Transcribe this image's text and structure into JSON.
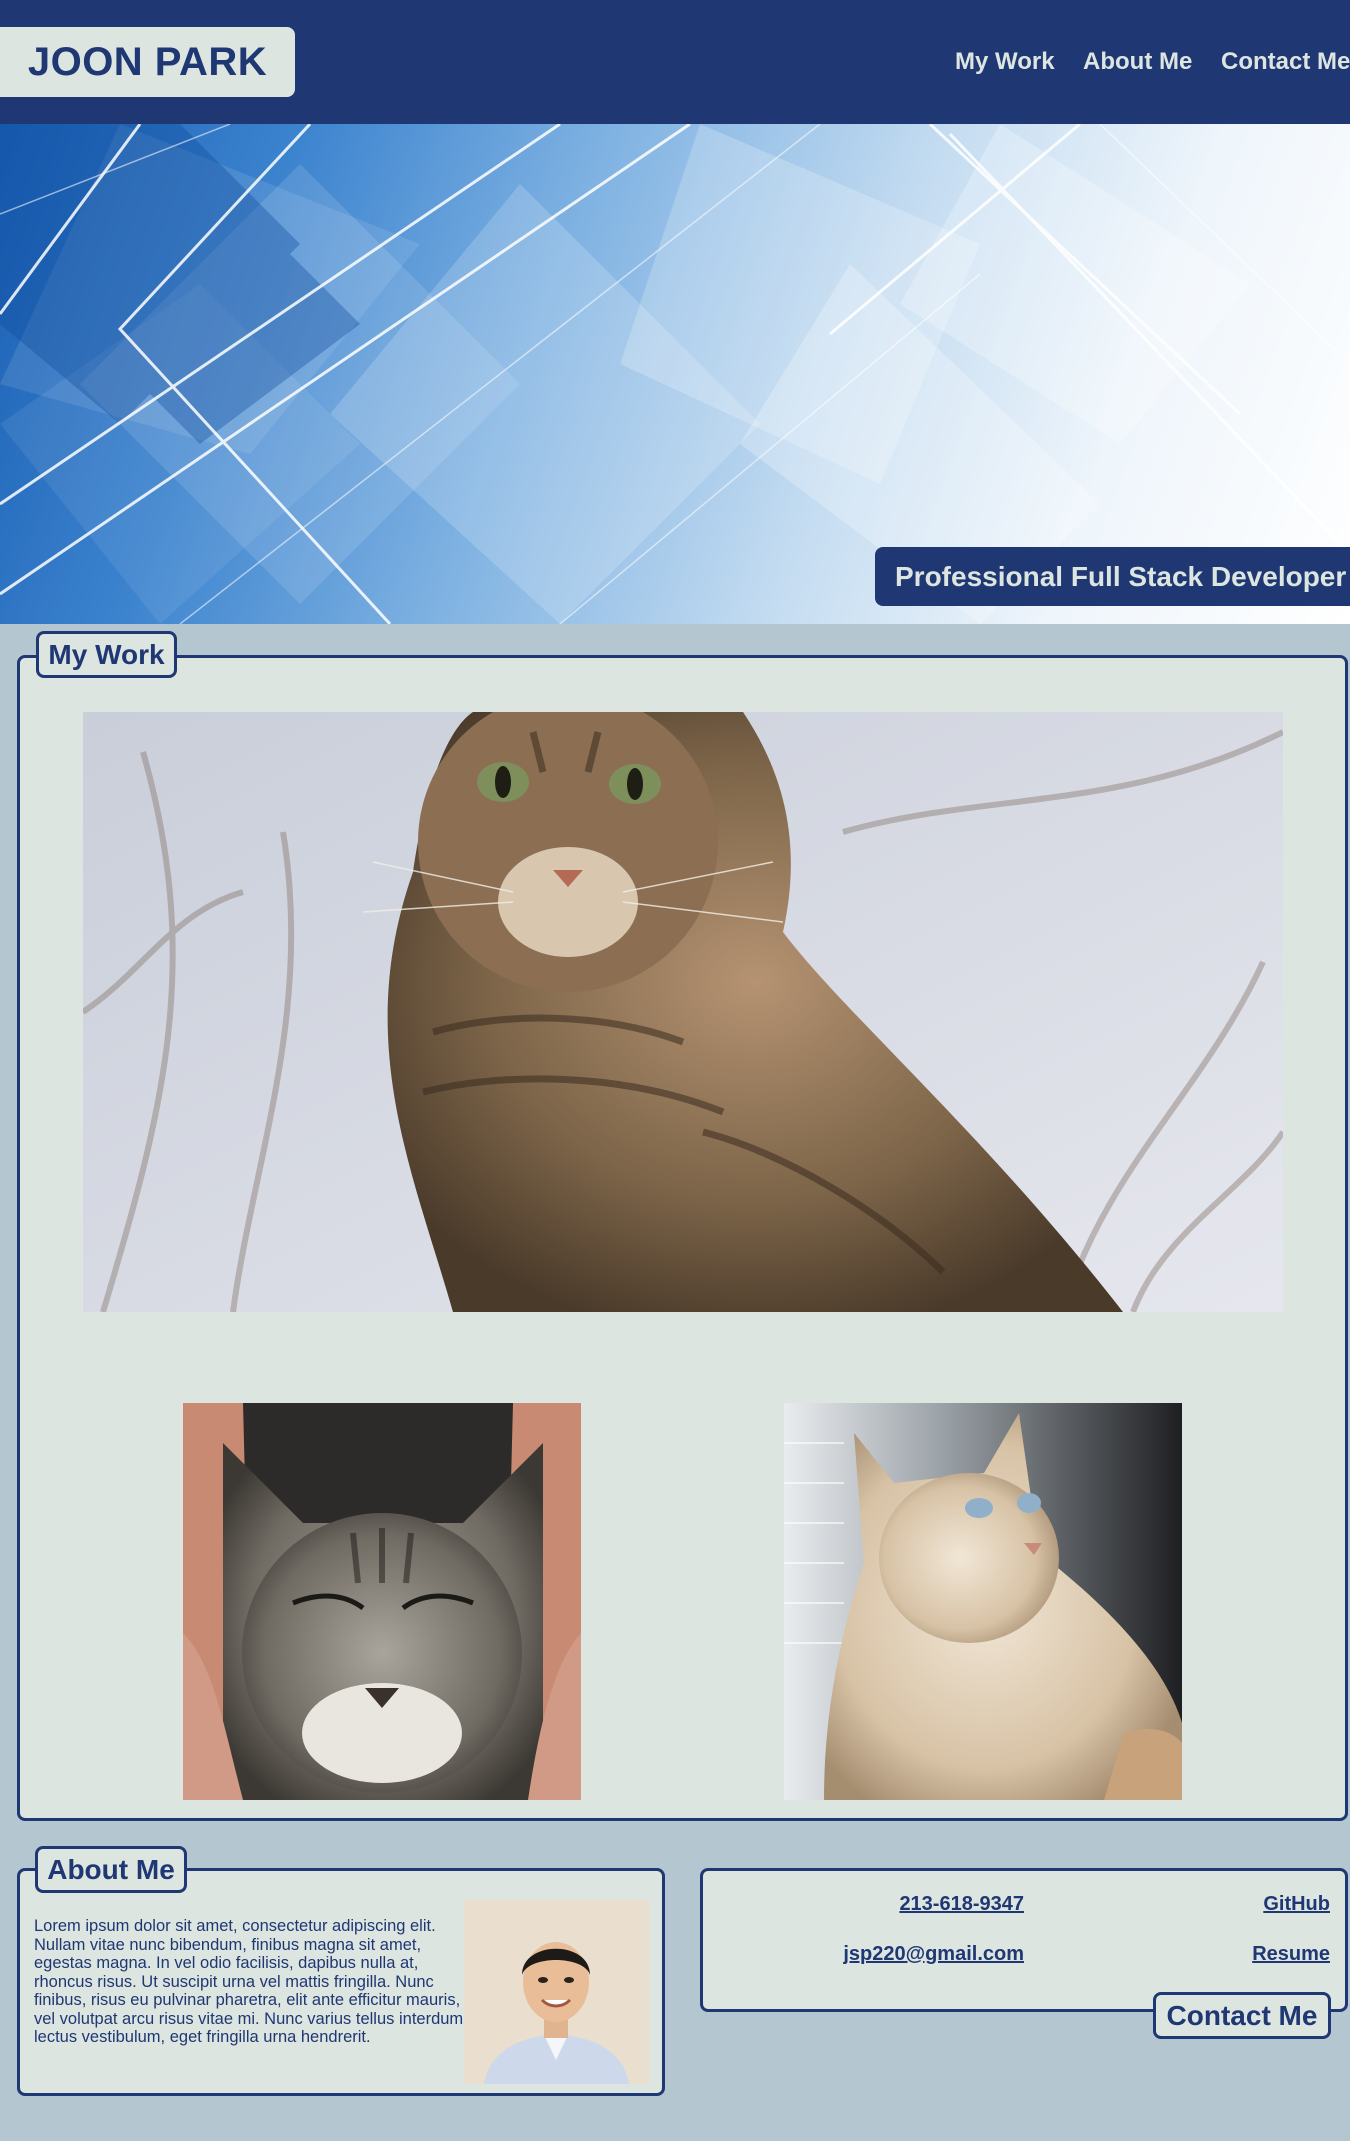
{
  "header": {
    "logo": "JOON PARK",
    "nav": [
      {
        "label": "My Work"
      },
      {
        "label": "About Me"
      },
      {
        "label": "Contact Me"
      }
    ]
  },
  "hero": {
    "tagline": "Professional Full Stack Developer"
  },
  "work": {
    "title": "My Work",
    "images": [
      {
        "subject": "tabby cat sitting"
      },
      {
        "subject": "kitten being petted"
      },
      {
        "subject": "cream cat by window"
      }
    ]
  },
  "about": {
    "title": "About Me",
    "text": "Lorem ipsum dolor sit amet, consectetur adipiscing elit. Nullam vitae nunc bibendum, finibus magna sit amet, egestas magna. In vel odio facilisis, dapibus nulla at, rhoncus risus. Ut suscipit urna vel mattis fringilla. Nunc finibus, risus eu pulvinar pharetra, elit ante efficitur mauris, vel volutpat arcu risus vitae mi. Nunc varius tellus interdum lectus vestibulum, eget fringilla urna hendrerit."
  },
  "contact": {
    "title": "Contact Me",
    "phone": "213-618-9347",
    "email": "jsp220@gmail.com",
    "github": "GitHub",
    "resume": "Resume"
  },
  "colors": {
    "navy": "#1f3773",
    "panel": "#dde5e0",
    "page_bg": "#b4c6cf"
  }
}
